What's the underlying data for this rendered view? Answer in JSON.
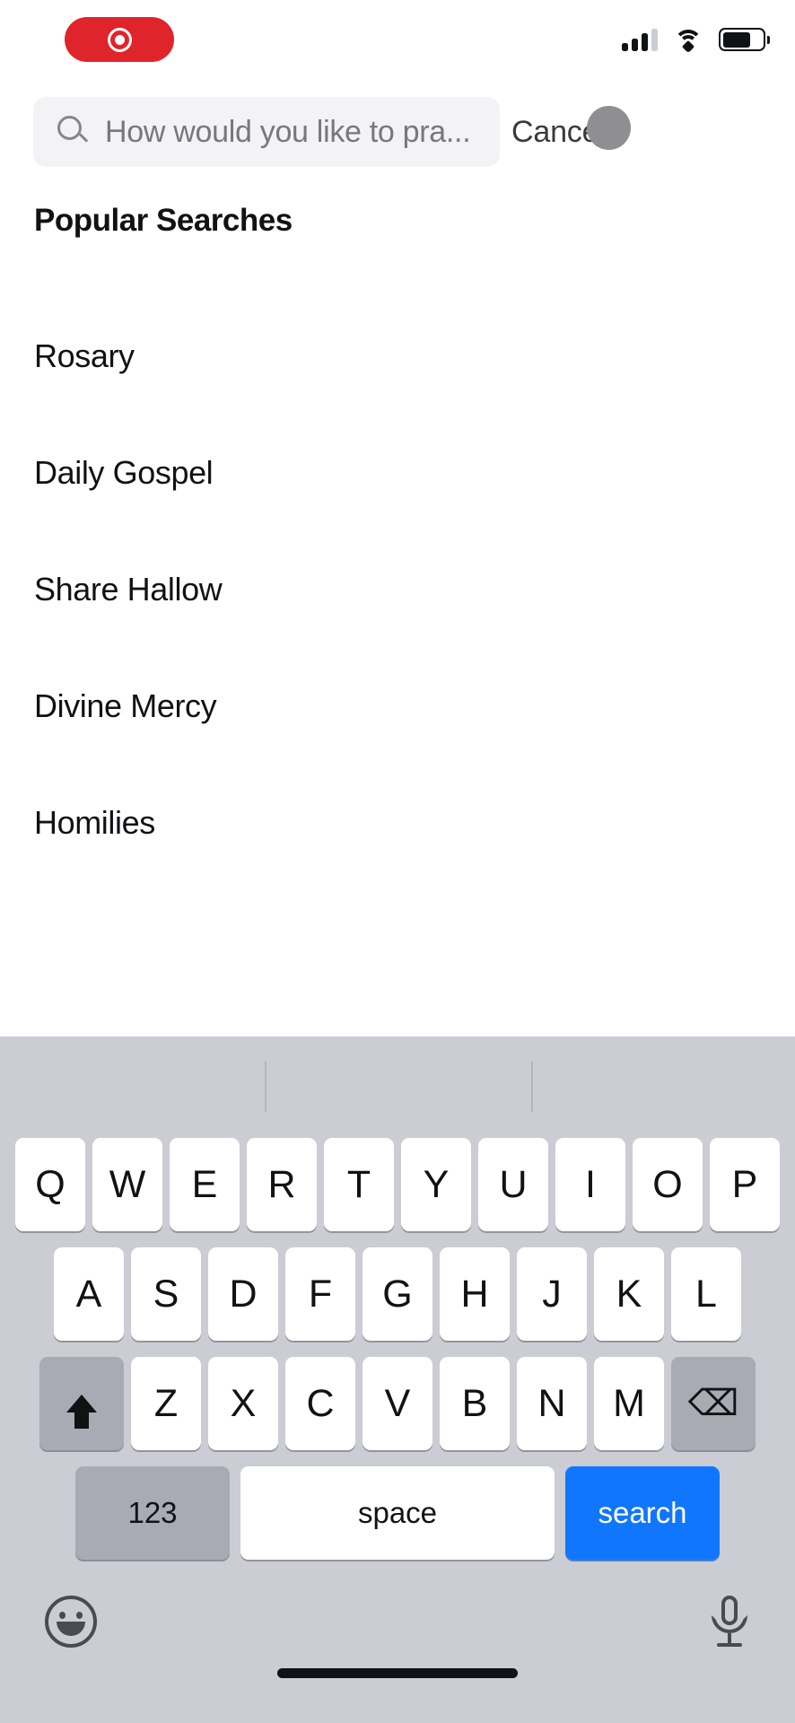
{
  "status_bar": {
    "recording_indicator": {
      "icon": "record-icon",
      "color": "#e0242b",
      "active": true
    },
    "cellular": {
      "icon": "cellular-signal-icon",
      "bars_filled": 3,
      "bars_total": 4
    },
    "wifi": {
      "icon": "wifi-icon",
      "strength": "full"
    },
    "battery": {
      "icon": "battery-icon",
      "level_percent": 70
    }
  },
  "search": {
    "icon": "search-icon",
    "placeholder": "How would you like to pra...",
    "value": "",
    "cancel_label": "Cancel",
    "background": "#f3f3f5"
  },
  "touch_indicator": {
    "name": "touch-pointer",
    "color": "#8e8e93"
  },
  "main": {
    "section_title": "Popular Searches",
    "items": [
      {
        "label": "Rosary"
      },
      {
        "label": "Daily Gospel"
      },
      {
        "label": "Share Hallow"
      },
      {
        "label": "Divine Mercy"
      },
      {
        "label": "Homilies"
      }
    ]
  },
  "keyboard": {
    "background": "#cbccd4",
    "predictive_suggestions": [
      "",
      "",
      ""
    ],
    "row1": [
      "Q",
      "W",
      "E",
      "R",
      "T",
      "Y",
      "U",
      "I",
      "O",
      "P"
    ],
    "row2": [
      "A",
      "S",
      "D",
      "F",
      "G",
      "H",
      "J",
      "K",
      "L"
    ],
    "row3_letters": [
      "Z",
      "X",
      "C",
      "V",
      "B",
      "N",
      "M"
    ],
    "shift_icon": "shift-icon",
    "backspace_icon": "backspace-icon",
    "backspace_glyph": "⌫",
    "numbers_label": "123",
    "space_label": "space",
    "search_label": "search",
    "search_key_color": "#1076fd",
    "emoji_icon": "emoji-icon",
    "dictation_icon": "microphone-icon"
  },
  "home_indicator": {
    "name": "home-indicator"
  }
}
